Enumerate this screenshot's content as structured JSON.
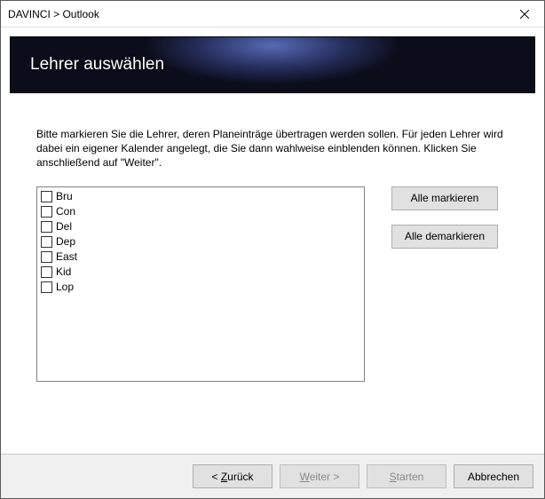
{
  "window": {
    "title": "DAVINCI > Outlook"
  },
  "header": {
    "title": "Lehrer auswählen"
  },
  "instructions": "Bitte markieren Sie die Lehrer, deren Planeinträge übertragen werden sollen. Für jeden Lehrer wird dabei ein eigener Kalender angelegt, die Sie dann wahlweise einblenden können. Klicken Sie anschließend auf \"Weiter\".",
  "teachers": [
    {
      "label": "Bru",
      "checked": false
    },
    {
      "label": "Con",
      "checked": false
    },
    {
      "label": "Del",
      "checked": false
    },
    {
      "label": "Dep",
      "checked": false
    },
    {
      "label": "East",
      "checked": false
    },
    {
      "label": "Kid",
      "checked": false
    },
    {
      "label": "Lop",
      "checked": false
    }
  ],
  "buttons": {
    "select_all": "Alle markieren",
    "deselect_all": "Alle demarkieren",
    "back_prefix": "< ",
    "back_accel": "Z",
    "back_suffix": "urück",
    "next_accel": "W",
    "next_suffix": "eiter >",
    "start_accel": "S",
    "start_suffix": "tarten",
    "cancel": "Abbrechen"
  },
  "state": {
    "next_enabled": false,
    "start_enabled": false
  }
}
